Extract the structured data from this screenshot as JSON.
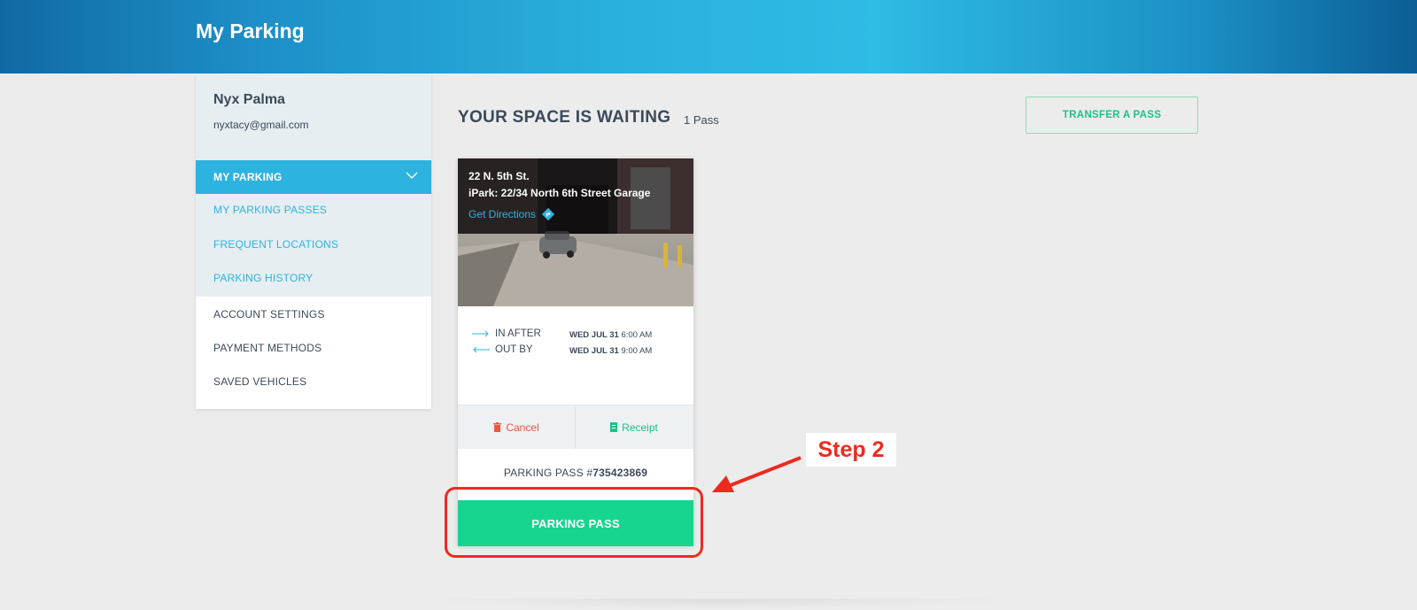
{
  "header": {
    "title": "My Parking"
  },
  "profile": {
    "name": "Nyx Palma",
    "email": "nyxtacy@gmail.com"
  },
  "sidebar": {
    "active": {
      "label": "MY PARKING"
    },
    "sub_items": [
      {
        "label": "MY PARKING PASSES"
      },
      {
        "label": "FREQUENT LOCATIONS"
      },
      {
        "label": "PARKING HISTORY"
      }
    ],
    "items": [
      {
        "label": "ACCOUNT SETTINGS"
      },
      {
        "label": "PAYMENT METHODS"
      },
      {
        "label": "SAVED VEHICLES"
      }
    ]
  },
  "main": {
    "title": "YOUR SPACE IS WAITING",
    "pass_count": "1 Pass",
    "transfer_label": "TRANSFER A PASS"
  },
  "pass": {
    "address": "22 N. 5th St.",
    "garage": "iPark: 22/34 North 6th Street Garage",
    "directions_label": "Get Directions",
    "in_label": "IN AFTER",
    "out_label": "OUT BY",
    "in_date": "WED JUL 31",
    "in_time": "6:00 AM",
    "out_date": "WED JUL 31",
    "out_time": "9:00 AM",
    "cancel_label": "Cancel",
    "receipt_label": "Receipt",
    "pass_number_prefix": "PARKING PASS #",
    "pass_number": "735423869",
    "pass_button_label": "PARKING PASS"
  },
  "annotation": {
    "label": "Step 2"
  },
  "colors": {
    "accent_blue": "#2db3e0",
    "accent_green": "#17d48f",
    "cancel_red": "#f0553f",
    "annotation_red": "#ee2a1f"
  }
}
